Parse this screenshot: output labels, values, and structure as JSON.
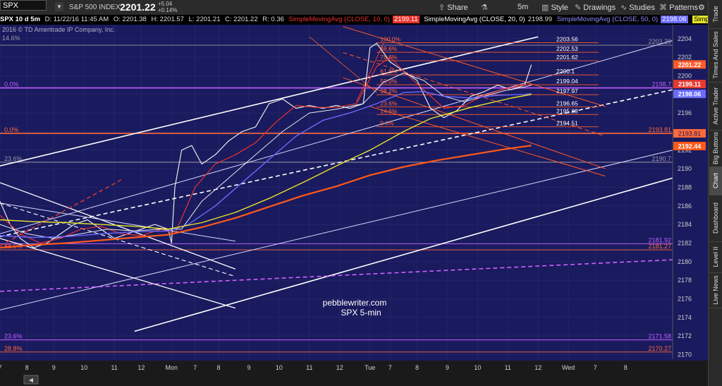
{
  "header": {
    "symbol": "SPX",
    "description": "S&P 500 INDEX",
    "last": "2201.22",
    "change": "+5.04",
    "change_pct": "+0.14%",
    "buttons": [
      {
        "name": "share-button",
        "label": "Share",
        "icon": "share-icon"
      },
      {
        "name": "flask-button",
        "label": "",
        "icon": "flask-icon"
      },
      {
        "name": "timeframe-button",
        "label": "5m",
        "icon": ""
      },
      {
        "name": "style-button",
        "label": "Style",
        "icon": "style-icon"
      },
      {
        "name": "drawings-button",
        "label": "Drawings",
        "icon": "pencil-icon"
      },
      {
        "name": "studies-button",
        "label": "Studies",
        "icon": "studies-icon"
      },
      {
        "name": "patterns-button",
        "label": "Patterns",
        "icon": "patterns-icon"
      }
    ]
  },
  "infobar": {
    "period": "SPX 10 d 5m",
    "date": "D: 11/22/16 11:45 AM",
    "open": "O: 2201.38",
    "high": "H: 2201.57",
    "low": "L: 2201.21",
    "close": "C: 2201.22",
    "range": "R: 0.36",
    "sma10_label": "SimpleMovingAvg (CLOSE, 10, 0)",
    "sma10_value": "2199.11",
    "sma20_label": "SimpleMovingAvg (CLOSE, 20, 0)",
    "sma20_value": "2198.99",
    "sma50_label": "SimpleMovingAvg (CLOSE, 50, 0)",
    "sma50_value": "2198.06",
    "more_label": "Simple..."
  },
  "sidebar": {
    "tabs": [
      "Trade",
      "Times And Sales",
      "Active Trader",
      "Big Buttons",
      "Chart",
      "Dashboard",
      "Level II",
      "Live News"
    ],
    "active": "Chart"
  },
  "chart_data": {
    "type": "line",
    "copyright": "2016 © TD Ameritrade IP Company, Inc.",
    "watermark": [
      "pebblewriter.com",
      "SPX 5-min"
    ],
    "colors": {
      "background": "#1a1a5e",
      "candle_up": "#39c84e",
      "candle_down": "#e8442a",
      "sma10": "#e8332c",
      "sma20": "#e8e8f0",
      "sma50": "#6a6aff",
      "sma_yellow": "#e6e62a",
      "sma_orange": "#ff5a1a",
      "price_tag": "#ff5a2a"
    },
    "ylim": [
      2169.5,
      2205.5
    ],
    "xlim": [
      0,
      10
    ],
    "y_ticks": [
      2170,
      2172,
      2174,
      2176,
      2178,
      2180,
      2182,
      2184,
      2186,
      2188,
      2190,
      2192,
      2194,
      2196,
      2198,
      2200,
      2202,
      2204
    ],
    "x_ticks": [
      {
        "x": 0.0,
        "label": "7"
      },
      {
        "x": 0.4,
        "label": "8"
      },
      {
        "x": 0.8,
        "label": "9"
      },
      {
        "x": 1.25,
        "label": "10"
      },
      {
        "x": 1.7,
        "label": "11"
      },
      {
        "x": 2.1,
        "label": "12"
      },
      {
        "x": 2.55,
        "label": "Mon"
      },
      {
        "x": 2.9,
        "label": "7"
      },
      {
        "x": 3.25,
        "label": "8"
      },
      {
        "x": 3.7,
        "label": "9"
      },
      {
        "x": 4.15,
        "label": "10"
      },
      {
        "x": 4.6,
        "label": "11"
      },
      {
        "x": 5.05,
        "label": "12"
      },
      {
        "x": 5.5,
        "label": "Tue"
      },
      {
        "x": 5.8,
        "label": "7"
      },
      {
        "x": 6.2,
        "label": "8"
      },
      {
        "x": 6.65,
        "label": "9"
      },
      {
        "x": 7.1,
        "label": "10"
      },
      {
        "x": 7.55,
        "label": "11"
      },
      {
        "x": 8.0,
        "label": "12"
      },
      {
        "x": 8.45,
        "label": "Wed"
      },
      {
        "x": 8.85,
        "label": "7"
      },
      {
        "x": 9.3,
        "label": "8"
      }
    ],
    "h_levels": [
      {
        "y": 2203.29,
        "label": "2203.29",
        "color": "#9a9aa8"
      },
      {
        "y": 2198.7,
        "label": "2198.7",
        "color": "#c060ff",
        "pct": "0.0%"
      },
      {
        "y": 2193.81,
        "label": "2193.81",
        "color": "#ff6a3a",
        "pct": "0.0%"
      },
      {
        "y": 2190.7,
        "label": "2190.7",
        "color": "#9a9aa8",
        "pct": "23.6%"
      },
      {
        "y": 2181.92,
        "label": "2181.92",
        "color": "#c060ff"
      },
      {
        "y": 2181.27,
        "label": "2181.27",
        "color": "#ff6a3a",
        "pct": "88.6%"
      },
      {
        "y": 2171.58,
        "label": "2171.58",
        "color": "#c060ff",
        "pct": "23.6%"
      },
      {
        "y": 2170.27,
        "label": "2170.27",
        "color": "#ff6a3a",
        "pct": "28.8%"
      }
    ],
    "top_left_pct": "14.6%",
    "fib_levels": [
      {
        "y": 2203.56,
        "label": "2203.56",
        "pct": "100.0%"
      },
      {
        "y": 2202.53,
        "label": "2202.53",
        "pct": "88.6%"
      },
      {
        "y": 2201.62,
        "label": "2201.62",
        "pct": "78.6%"
      },
      {
        "y": 2200.1,
        "label": "2200.1",
        "pct": "61.8%"
      },
      {
        "y": 2199.04,
        "label": "2199.04",
        "pct": "50.0%"
      },
      {
        "y": 2197.97,
        "label": "2197.97",
        "pct": "38.2%"
      },
      {
        "y": 2196.65,
        "label": "2196.65",
        "pct": "23.6%"
      },
      {
        "y": 2195.83,
        "label": "2195.83",
        "pct": "14.6%"
      },
      {
        "y": 2194.51,
        "label": "2194.51",
        "pct": "0.0%"
      }
    ],
    "right_tags": [
      {
        "y": 2201.22,
        "label": "2201.22",
        "color": "#ff5a2a"
      },
      {
        "y": 2199.11,
        "label": "2199.11",
        "color": "#e83a30"
      },
      {
        "y": 2198.06,
        "label": "2198.06",
        "color": "#6a6aff"
      },
      {
        "y": 2192.44,
        "label": "2192.44",
        "color": "#ff5a1a"
      }
    ],
    "series": [
      {
        "name": "close",
        "color": "#e8e8e8",
        "width": 1.2,
        "x": [
          0,
          0.15,
          0.3,
          0.5,
          0.7,
          0.9,
          1.1,
          1.3,
          1.5,
          1.7,
          1.9,
          2.1,
          2.3,
          2.5,
          2.55,
          2.6,
          2.7,
          2.85,
          3.0,
          3.2,
          3.4,
          3.6,
          3.8,
          4.0,
          4.2,
          4.4,
          4.6,
          4.8,
          5.0,
          5.2,
          5.4,
          5.5,
          5.6,
          5.8,
          6.0,
          6.2,
          6.4,
          6.6,
          6.8,
          7.0,
          7.2,
          7.4,
          7.6,
          7.8,
          7.9
        ],
        "y": [
          2186.5,
          2184,
          2182.5,
          2181.5,
          2182,
          2183,
          2184,
          2184.5,
          2183.5,
          2182.5,
          2183,
          2183.5,
          2184,
          2183.5,
          2182,
          2188,
          2192,
          2192.5,
          2190.5,
          2191.5,
          2193,
          2194,
          2194.5,
          2197,
          2197.5,
          2196.5,
          2196.8,
          2196.5,
          2196.8,
          2196.5,
          2197,
          2203,
          2203.5,
          2201.5,
          2200.5,
          2199.5,
          2196.5,
          2195.5,
          2196.3,
          2197.8,
          2198.3,
          2199,
          2198.5,
          2199,
          2201.2
        ]
      },
      {
        "name": "SimpleMovingAvg (CLOSE, 10, 0)",
        "color": "#e8332c",
        "width": 1.2,
        "x": [
          0,
          0.3,
          0.6,
          0.9,
          1.2,
          1.5,
          1.8,
          2.1,
          2.4,
          2.6,
          2.9,
          3.2,
          3.5,
          3.8,
          4.1,
          4.4,
          4.7,
          5.0,
          5.3,
          5.6,
          5.8,
          6.0,
          6.3,
          6.6,
          6.9,
          7.2,
          7.5,
          7.8,
          7.9
        ],
        "y": [
          2185,
          2183,
          2182,
          2182.5,
          2183.5,
          2183.8,
          2183,
          2182.8,
          2183.5,
          2183,
          2188,
          2190.5,
          2191.5,
          2192.8,
          2195,
          2196.8,
          2196.6,
          2196.6,
          2197,
          2201,
          2202,
          2200.5,
          2198.5,
          2196.5,
          2196.8,
          2197.9,
          2198.6,
          2199,
          2199.1
        ]
      },
      {
        "name": "SimpleMovingAvg (CLOSE, 20, 0)",
        "color": "#e8e8f0",
        "width": 1.0,
        "x": [
          0,
          0.4,
          0.8,
          1.2,
          1.6,
          2.0,
          2.4,
          2.7,
          3.0,
          3.4,
          3.8,
          4.2,
          4.6,
          5.0,
          5.4,
          5.7,
          6.0,
          6.3,
          6.6,
          6.9,
          7.2,
          7.5,
          7.8,
          7.9
        ],
        "y": [
          2184,
          2183,
          2182.5,
          2183,
          2183.5,
          2183.3,
          2183.5,
          2183.5,
          2186.5,
          2189,
          2191.5,
          2194,
          2196,
          2196.4,
          2197,
          2199.3,
          2200.3,
          2199.5,
          2197.8,
          2197.2,
          2197.8,
          2198.4,
          2198.8,
          2199
        ]
      },
      {
        "name": "SimpleMovingAvg (CLOSE, 50, 0)",
        "color": "#6a6aff",
        "width": 1.4,
        "x": [
          0,
          0.5,
          1.0,
          1.5,
          2.0,
          2.5,
          2.8,
          3.2,
          3.6,
          4.0,
          4.4,
          4.8,
          5.2,
          5.6,
          6.0,
          6.3,
          6.6,
          7.0,
          7.4,
          7.8,
          7.9
        ],
        "y": [
          2182.8,
          2182.6,
          2182.7,
          2183,
          2183.2,
          2183.3,
          2184,
          2186,
          2188.5,
          2191,
          2193.5,
          2195.2,
          2196,
          2197,
          2198.2,
          2198.3,
          2197.8,
          2197.6,
          2197.9,
          2198,
          2198.1
        ]
      },
      {
        "name": "sma-yellow",
        "color": "#e6e62a",
        "width": 1.4,
        "x": [
          0,
          0.5,
          1.0,
          1.5,
          2.0,
          2.5,
          3.0,
          3.5,
          4.0,
          4.5,
          5.0,
          5.5,
          6.0,
          6.4,
          6.7,
          7.0,
          7.3,
          7.6,
          7.9
        ],
        "y": [
          2184.5,
          2184.3,
          2184.2,
          2184,
          2183.8,
          2183.5,
          2184.2,
          2185.3,
          2186.8,
          2188.5,
          2190.3,
          2192,
          2194,
          2195.4,
          2196,
          2196.6,
          2197.1,
          2197.6,
          2198
        ]
      },
      {
        "name": "sma-orange",
        "color": "#ff5a1a",
        "width": 2.2,
        "x": [
          0,
          0.5,
          1.0,
          1.5,
          2.0,
          2.5,
          3.0,
          3.5,
          4.0,
          4.5,
          5.0,
          5.5,
          6.0,
          6.5,
          7.0,
          7.5,
          7.9
        ],
        "y": [
          2181.5,
          2181.8,
          2182,
          2182.3,
          2182.6,
          2182.9,
          2183.7,
          2184.7,
          2185.9,
          2187.1,
          2188.1,
          2189.3,
          2190.2,
          2190.9,
          2191.5,
          2192.1,
          2192.5
        ]
      }
    ],
    "trendlines": [
      {
        "x1": 0,
        "y1": 2190.3,
        "x2": 8.0,
        "y2": 2204.2,
        "color": "#ffffff",
        "width": 1.6,
        "dash": ""
      },
      {
        "x1": 0,
        "y1": 2183.0,
        "x2": 10,
        "y2": 2203.8,
        "color": "#d8d8ff",
        "width": 1,
        "dash": ""
      },
      {
        "x1": 0,
        "y1": 2182.7,
        "x2": 10,
        "y2": 2198.5,
        "color": "#ffffff",
        "width": 1.6,
        "dash": "6,4"
      },
      {
        "x1": 0,
        "y1": 2174.8,
        "x2": 10,
        "y2": 2192.0,
        "color": "#d8d8ff",
        "width": 1,
        "dash": ""
      },
      {
        "x1": 2.0,
        "y1": 2172.5,
        "x2": 10,
        "y2": 2189.0,
        "color": "#ffffff",
        "width": 1.6,
        "dash": ""
      },
      {
        "x1": 0,
        "y1": 2176.8,
        "x2": 10,
        "y2": 2180.2,
        "color": "#d060ff",
        "width": 1.6,
        "dash": "6,4"
      },
      {
        "x1": 0,
        "y1": 2188.5,
        "x2": 3.5,
        "y2": 2179.2,
        "color": "#ffffff",
        "width": 1.3,
        "dash": ""
      },
      {
        "x1": 0,
        "y1": 2186.3,
        "x2": 3.5,
        "y2": 2182.2,
        "color": "#d8d8ff",
        "width": 1,
        "dash": ""
      },
      {
        "x1": 0,
        "y1": 2182.5,
        "x2": 3.5,
        "y2": 2175.0,
        "color": "#ffffff",
        "width": 1.3,
        "dash": ""
      },
      {
        "x1": 0,
        "y1": 2186.3,
        "x2": 3.5,
        "y2": 2178.4,
        "color": "#ffffff",
        "width": 1.1,
        "dash": "6,4"
      },
      {
        "x1": 0,
        "y1": 2181.7,
        "x2": 1.8,
        "y2": 2188.8,
        "color": "#e83a30",
        "width": 1.4,
        "dash": "6,4"
      },
      {
        "x1": 5.1,
        "y1": 2205.3,
        "x2": 9.0,
        "y2": 2196.7,
        "color": "#ff5a2a",
        "width": 1,
        "dash": ""
      },
      {
        "x1": 5.1,
        "y1": 2202.5,
        "x2": 9.0,
        "y2": 2193.5,
        "color": "#ff5a2a",
        "width": 1,
        "dash": "6,4"
      },
      {
        "x1": 5.1,
        "y1": 2199.8,
        "x2": 9.0,
        "y2": 2190.0,
        "color": "#ff5a2a",
        "width": 1,
        "dash": ""
      },
      {
        "x1": 5.5,
        "y1": 2196.7,
        "x2": 9.0,
        "y2": 2189.2,
        "color": "#ff5a2a",
        "width": 1,
        "dash": ""
      },
      {
        "x1": 4.6,
        "y1": 2204.2,
        "x2": 5.6,
        "y2": 2198.2,
        "color": "#ff5a2a",
        "width": 0.8,
        "dash": ""
      },
      {
        "x1": 5.3,
        "y1": 2197.2,
        "x2": 5.7,
        "y2": 2203.5,
        "color": "#e83a30",
        "width": 1,
        "dash": ""
      }
    ]
  }
}
